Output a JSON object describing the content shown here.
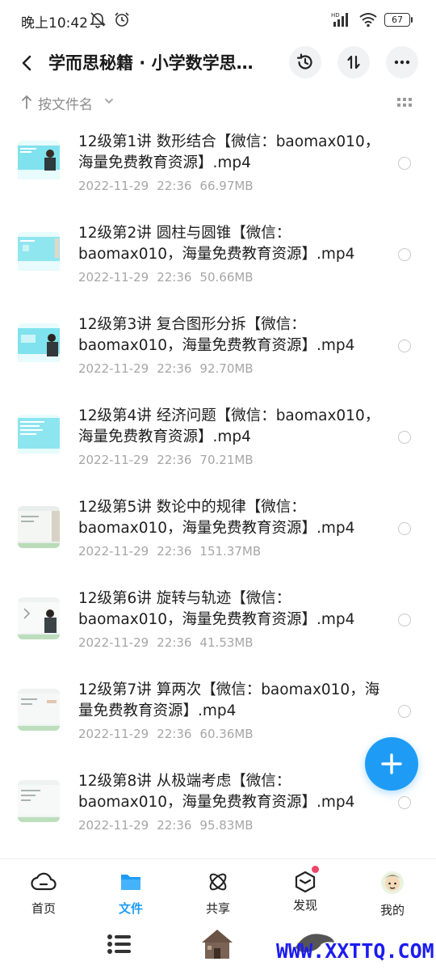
{
  "status_bar": {
    "time": "晚上10:42",
    "battery": "67",
    "network": "HD"
  },
  "header": {
    "title": "学而思秘籍 · 小学数学思…"
  },
  "sort": {
    "label": "按文件名"
  },
  "files": [
    {
      "name": "12级第1讲 数形结合【微信：baomax010，海量免费教育资源】.mp4",
      "date": "2022-11-29",
      "time": "22:36",
      "size": "66.97MB"
    },
    {
      "name": "12级第2讲 圆柱与圆锥【微信：baomax010，海量免费教育资源】.mp4",
      "date": "2022-11-29",
      "time": "22:36",
      "size": "50.66MB"
    },
    {
      "name": "12级第3讲 复合图形分拆【微信：baomax010，海量免费教育资源】.mp4",
      "date": "2022-11-29",
      "time": "22:36",
      "size": "92.70MB"
    },
    {
      "name": "12级第4讲 经济问题【微信：baomax010，海量免费教育资源】.mp4",
      "date": "2022-11-29",
      "time": "22:36",
      "size": "70.21MB"
    },
    {
      "name": "12级第5讲 数论中的规律【微信：baomax010，海量免费教育资源】.mp4",
      "date": "2022-11-29",
      "time": "22:36",
      "size": "151.37MB"
    },
    {
      "name": "12级第6讲 旋转与轨迹【微信：baomax010，海量免费教育资源】.mp4",
      "date": "2022-11-29",
      "time": "22:36",
      "size": "41.53MB"
    },
    {
      "name": "12级第7讲 算两次【微信：baomax010，海量免费教育资源】.mp4",
      "date": "2022-11-29",
      "time": "22:36",
      "size": "60.36MB"
    },
    {
      "name": "12级第8讲 从极端考虑【微信：baomax010，海量免费教育资源】.mp4",
      "date": "2022-11-29",
      "time": "22:36",
      "size": "95.83MB"
    }
  ],
  "nav": {
    "items": [
      {
        "label": "首页",
        "icon": "cloud-icon"
      },
      {
        "label": "文件",
        "icon": "folder-icon",
        "active": true
      },
      {
        "label": "共享",
        "icon": "atom-icon"
      },
      {
        "label": "发现",
        "icon": "cube-icon",
        "badge": true
      },
      {
        "label": "我的",
        "icon": "avatar-icon"
      }
    ]
  },
  "watermark": "WWW.XXTTQ.COM",
  "colors": {
    "accent": "#1e9cf5",
    "badge": "#f0446a",
    "meta": "#a6a6a6"
  }
}
